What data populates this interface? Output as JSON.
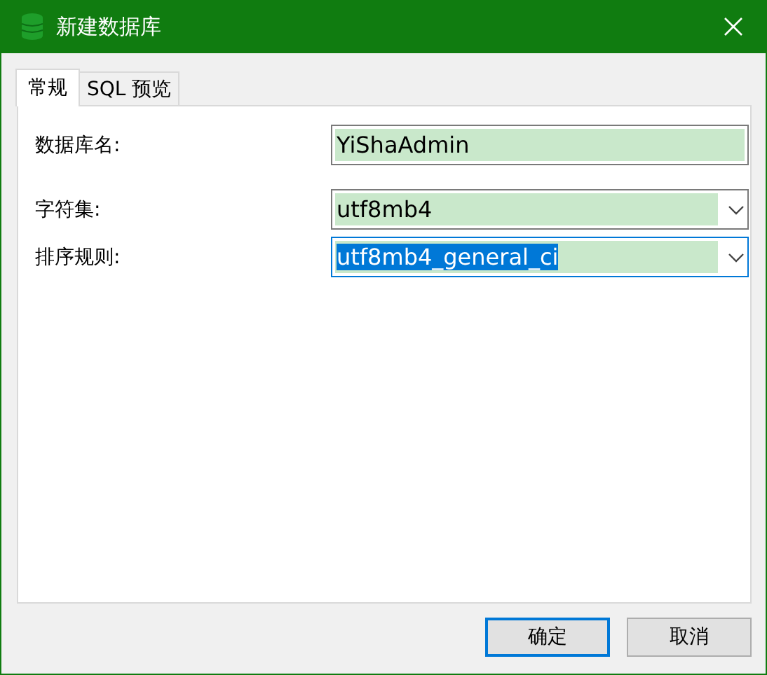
{
  "window": {
    "title": "新建数据库"
  },
  "tabs": [
    {
      "label": "常规",
      "selected": true
    },
    {
      "label": "SQL 预览",
      "selected": false
    }
  ],
  "fields": [
    {
      "kind": "text",
      "label": "数据库名:",
      "value": "YiShaAdmin",
      "focused": false
    },
    {
      "kind": "select",
      "label": "字符集:",
      "value": "utf8mb4",
      "focused": false
    },
    {
      "kind": "select",
      "label": "排序规则:",
      "value": "utf8mb4_general_ci",
      "focused": true
    }
  ],
  "buttons": [
    {
      "label": "确定",
      "default": true
    },
    {
      "label": "取消",
      "default": false
    }
  ]
}
